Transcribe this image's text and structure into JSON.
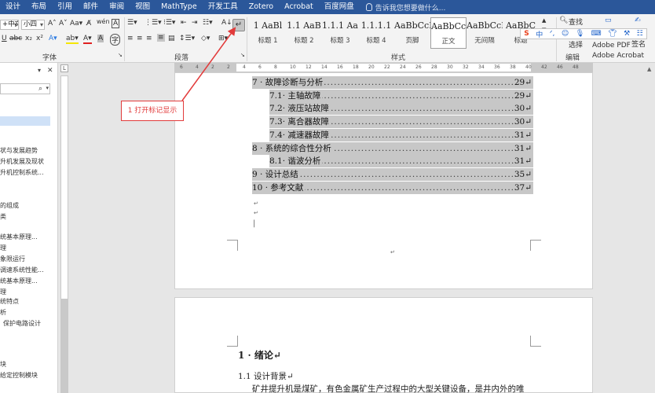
{
  "menubar": {
    "items": [
      "设计",
      "布局",
      "引用",
      "邮件",
      "审阅",
      "视图",
      "MathType",
      "开发工具",
      "Zotero",
      "Acrobat",
      "百度网盘"
    ],
    "tell_me": "告诉我您想要做什么..."
  },
  "ribbon": {
    "font_name": "+中文正",
    "font_size": "小四",
    "font_group_label": "字体",
    "paragraph_group_label": "段落",
    "styles_group_label": "样式",
    "editing_group_label": "编辑",
    "find_label": "查找",
    "select_label": "选择",
    "adobe_pdf_label": "Adobe PDF",
    "adobe_acrobat_label": "Adobe Acrobat",
    "sign_label": "请求签名",
    "styles": [
      {
        "sample": "1  AaBl",
        "name": "标题 1"
      },
      {
        "sample": "1.1  AaB",
        "name": "标题 2"
      },
      {
        "sample": "1.1.1  Aa",
        "name": "标题 3"
      },
      {
        "sample": "1.1.1.1",
        "name": "标题 4"
      },
      {
        "sample": "AaBbCcDdI",
        "name": "页脚"
      },
      {
        "sample": "AaBbCcI",
        "name": "正文"
      },
      {
        "sample": "AaBbCcI",
        "name": "无间隔"
      },
      {
        "sample": "AaBbC",
        "name": "标题"
      }
    ]
  },
  "nav": {
    "items": [
      "状与发展趋势",
      "升机发展及现状",
      "升机控制系统...",
      "的组成",
      "类",
      "统基本原理...",
      "理",
      "象限运行",
      "调速系统性能...",
      "统基本原理...",
      "理",
      "统特点",
      "析",
      "保护电路设计",
      "块",
      "给定控制模块"
    ]
  },
  "ruler": {
    "ticks": [
      "6",
      "4",
      "2",
      "2",
      "4",
      "6",
      "8",
      "10",
      "12",
      "14",
      "16",
      "18",
      "20",
      "22",
      "24",
      "26",
      "28",
      "30",
      "32",
      "34",
      "36",
      "38",
      "40",
      "42",
      "46",
      "48"
    ]
  },
  "toc": [
    {
      "title": "7 · 故障诊断与分析",
      "page": "29↵",
      "level": 1
    },
    {
      "title": "7.1· 主轴故障",
      "page": "29↵",
      "level": 2
    },
    {
      "title": "7.2· 液压站故障",
      "page": "30↵",
      "level": 2
    },
    {
      "title": "7.3· 离合器故障",
      "page": "30↵",
      "level": 2
    },
    {
      "title": "7.4· 减速器故障",
      "page": "31↵",
      "level": 2
    },
    {
      "title": "8 · 系统的综合性分析",
      "page": "31↵",
      "level": 1
    },
    {
      "title": "8.1· 谐波分析",
      "page": "31↵",
      "level": 2
    },
    {
      "title": "9 · 设计总结",
      "page": "35↵",
      "level": 1
    },
    {
      "title": "10 · 参考文献",
      "page": "37↵",
      "level": 1
    }
  ],
  "page2": {
    "heading1": "1 · 绪论↵",
    "heading2": "1.1  设计背景↵",
    "body": "矿井提升机是煤矿，有色金属矿生产过程中的大型关键设备，是井内外的唯"
  },
  "annotation": {
    "text": "1 打开标记显示",
    "color": "#e23b3b"
  },
  "colors": {
    "menubar": "#2b579a",
    "toc_highlight": "#c7c7c7"
  }
}
